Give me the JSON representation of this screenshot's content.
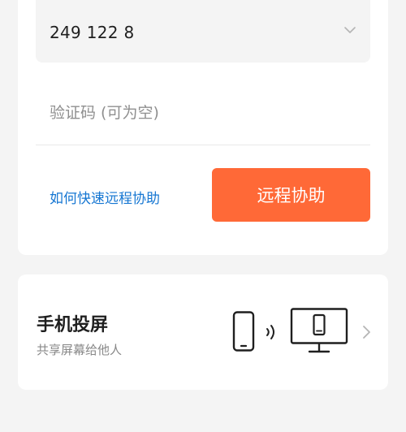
{
  "remote": {
    "device_id": "249 122 8",
    "code_placeholder": "验证码 (可为空)",
    "help_link": "如何快速远程协助",
    "assist_button": "远程协助"
  },
  "cast": {
    "title": "手机投屏",
    "subtitle": "共享屏幕给他人"
  },
  "icons": {
    "dropdown": "chevron-down-icon",
    "phone": "phone-icon",
    "wave": "signal-wave-icon",
    "monitor": "monitor-icon",
    "arrow": "chevron-right-icon"
  },
  "colors": {
    "accent": "#ff6937",
    "link": "#1576d2",
    "background": "#f4f4f4"
  }
}
